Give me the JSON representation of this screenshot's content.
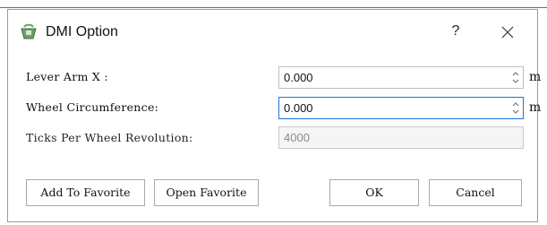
{
  "window": {
    "title": "DMI Option",
    "help_label": "?",
    "icons": {
      "app": "dmi-app-icon",
      "close": "close-icon"
    }
  },
  "form": {
    "lever_arm": {
      "label": "Lever Arm X :",
      "value": "0.000",
      "unit": "m"
    },
    "wheel_circumference": {
      "label": "Wheel Circumference:",
      "value": "0.000",
      "unit": "m"
    },
    "ticks_per_rev": {
      "label": "Ticks Per Wheel Revolution:",
      "value": "4000"
    }
  },
  "buttons": {
    "add_favorite": "Add To Favorite",
    "open_favorite": "Open Favorite",
    "ok": "OK",
    "cancel": "Cancel"
  },
  "colors": {
    "focus_border": "#1a74d6",
    "border": "#a9a9a9",
    "disabled_text": "#8a8a8a"
  }
}
